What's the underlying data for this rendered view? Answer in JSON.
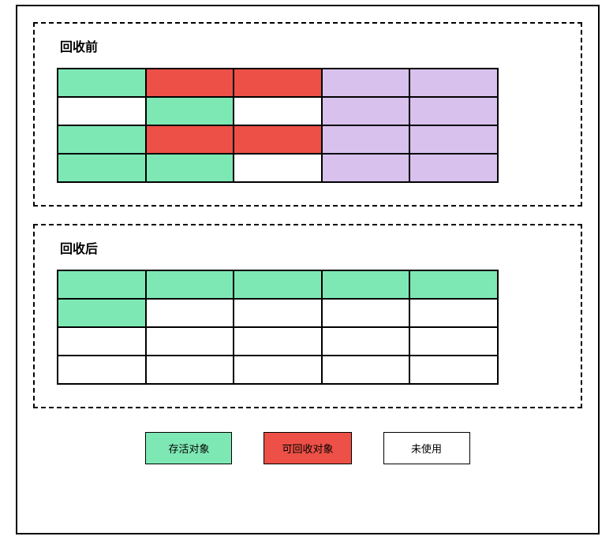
{
  "before": {
    "title": "回收前",
    "grid": [
      [
        "green",
        "red",
        "red",
        "purple",
        "purple"
      ],
      [
        "white",
        "green",
        "white",
        "purple",
        "purple"
      ],
      [
        "green",
        "red",
        "red",
        "purple",
        "purple"
      ],
      [
        "green",
        "green",
        "white",
        "purple",
        "purple"
      ]
    ]
  },
  "after": {
    "title": "回收后",
    "grid": [
      [
        "green",
        "green",
        "green",
        "green",
        "green"
      ],
      [
        "green",
        "white",
        "white",
        "white",
        "white"
      ],
      [
        "white",
        "white",
        "white",
        "white",
        "white"
      ],
      [
        "white",
        "white",
        "white",
        "white",
        "white"
      ]
    ]
  },
  "legend": {
    "alive": "存活对象",
    "reclaimable": "可回收对象",
    "unused": "未使用"
  },
  "colors": {
    "green": "#7ee8b4",
    "red": "#ec5046",
    "purple": "#d8c1ed",
    "white": "#ffffff"
  }
}
